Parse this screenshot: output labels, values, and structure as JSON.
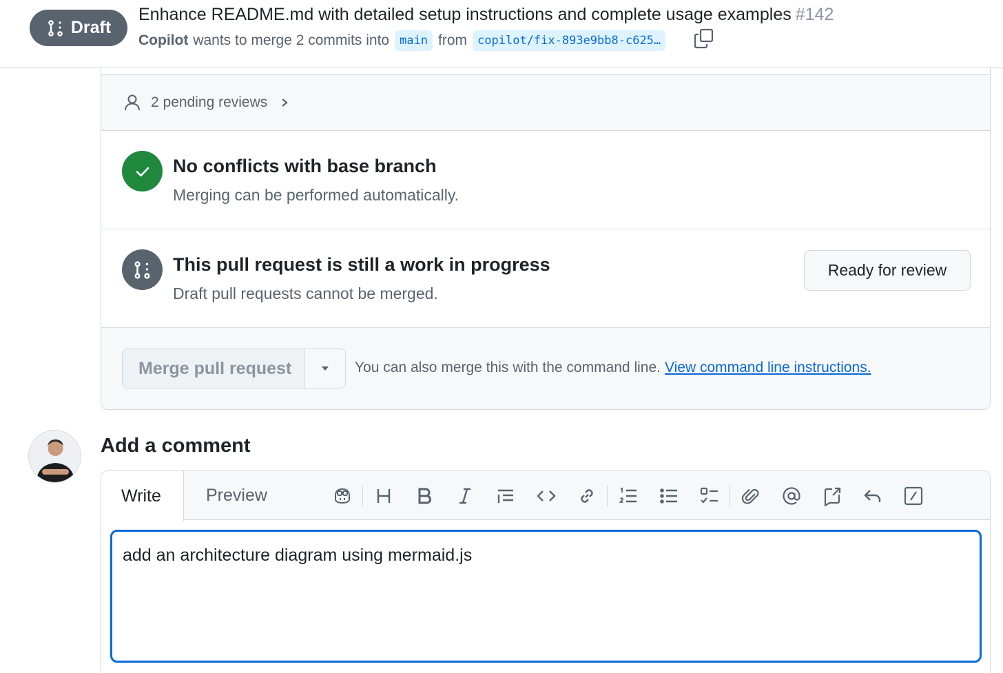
{
  "header": {
    "state_badge": "Draft",
    "title": "Enhance README.md with detailed setup instructions and complete usage examples",
    "number": "#142",
    "author": "Copilot",
    "merge_text": "wants to merge 2 commits into",
    "base_branch": "main",
    "from_text": "from",
    "head_branch": "copilot/fix-893e9bb8-c625…"
  },
  "merge_box": {
    "pending_reviews": "2 pending reviews",
    "conflicts": {
      "title": "No conflicts with base branch",
      "description": "Merging can be performed automatically."
    },
    "wip": {
      "title": "This pull request is still a work in progress",
      "description": "Draft pull requests cannot be merged.",
      "ready_button": "Ready for review"
    },
    "merge_button": "Merge pull request",
    "cli_note": "You can also merge this with the command line.",
    "cli_link": "View command line instructions."
  },
  "comment": {
    "heading": "Add a comment",
    "tab_write": "Write",
    "tab_preview": "Preview",
    "input_value": "add an architecture diagram using mermaid.js"
  },
  "icons": {
    "toolbar": [
      "copilot-icon",
      "heading-icon",
      "bold-icon",
      "italic-icon",
      "quote-icon",
      "code-icon",
      "link-icon",
      "ordered-list-icon",
      "unordered-list-icon",
      "task-list-icon",
      "attach-icon",
      "mention-icon",
      "reference-icon",
      "reply-icon",
      "slash-command-icon"
    ]
  },
  "colors": {
    "draft_badge": "#59636e",
    "success": "#1f883d",
    "accent": "#0969da",
    "muted_text": "#59636e",
    "border": "#d1d9e0"
  }
}
